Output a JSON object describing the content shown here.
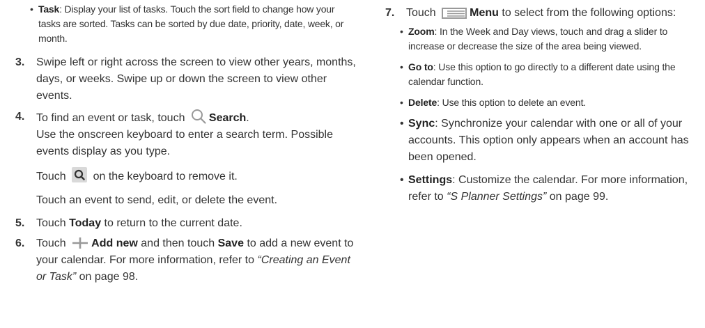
{
  "left": {
    "task_bullet": {
      "term": "Task",
      "text": ": Display your list of tasks. Touch the sort field to change how your tasks are sorted. Tasks can be sorted by due date, priority, date, week, or month."
    },
    "step3": {
      "num": "3.",
      "text": "Swipe left or right across the screen to view other years, months, days, or weeks. Swipe up or down the screen to view other events."
    },
    "step4": {
      "num": "4.",
      "pre": "To find an event or task, touch",
      "term": "Search",
      "post": ".",
      "line2": "Use the onscreen keyboard to enter a search term. Possible events display as you type.",
      "line3_pre": "Touch",
      "line3_post": "on the keyboard to remove it.",
      "line4": "Touch an event to send, edit, or delete the event."
    },
    "step5": {
      "num": "5.",
      "pre": "Touch",
      "term": "Today",
      "post": "to return to the current date."
    },
    "step6": {
      "num": "6.",
      "pre": "Touch",
      "term1": "Add new",
      "mid": "and then touch",
      "term2": "Save",
      "post": "to add a new event to your calendar. For more information, refer to",
      "ref": "“Creating an Event or Task”",
      "page": "on page 98."
    }
  },
  "right": {
    "step7": {
      "num": "7.",
      "pre": "Touch",
      "term": "Menu",
      "post": "to select from the following options:"
    },
    "zoom": {
      "term": "Zoom",
      "text": ": In the Week and Day views, touch and drag a slider to increase or decrease the size of the area being viewed."
    },
    "goto": {
      "term": "Go to",
      "text": ": Use this option to go directly to a different date using the calendar function."
    },
    "delete": {
      "term": "Delete",
      "text": ": Use this option to delete an event."
    },
    "sync": {
      "term": "Sync",
      "text": ": Synchronize your calendar with one or all of your accounts. This option only appears when an account has been opened."
    },
    "settings": {
      "term": "Settings",
      "text": ": Customize the calendar. For more information, refer to",
      "ref": "“S Planner Settings”",
      "page": "on page 99."
    }
  },
  "bullet_char": "•",
  "icons": [
    "search-icon",
    "keyboard-search-key-icon",
    "plus-icon",
    "menu-icon"
  ],
  "colors": {
    "text": "#333333",
    "icon_gray": "#999999",
    "key_bg": "#d9d9d9",
    "key_icon": "#333333"
  }
}
